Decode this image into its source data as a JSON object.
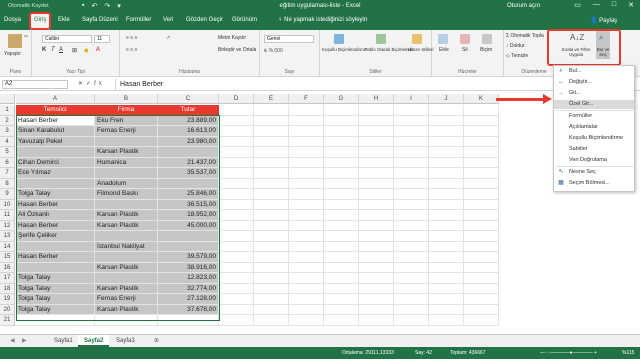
{
  "titlebar": {
    "autosave": "Otomatik Kaydet",
    "title": "eğitim uygulaması-liste  -  Excel",
    "user": "Oturum açın"
  },
  "tabs": [
    "Dosya",
    "Giriş",
    "Ekle",
    "Sayfa Düzeni",
    "Formüller",
    "Veri",
    "Gözden Geçir",
    "Görünüm"
  ],
  "tell_me": "Ne yapmak istediğinizi söyleyin",
  "share": "Paylaş",
  "ribbon": {
    "paste": "Yapıştır",
    "font_name": "Calibri",
    "font_size": "11",
    "wrap_text": "Metni Kaydır",
    "merge_center": "Birleştir ve Ortala",
    "number_format": "Genel",
    "conditional_format": "Koşullu Biçimlendirme",
    "format_as_table": "Tablo Olarak Biçimlendir",
    "cell_styles": "Hücre Stilleri",
    "insert": "Ekle",
    "delete": "Sil",
    "format": "Biçim",
    "autosum": "Otomatik Topla",
    "fill": "Doldur",
    "clear": "Temizle",
    "sort_filter": "Sırala ve Filtre Uygula",
    "find_select": "Bul ve Seç",
    "groups": {
      "clipboard": "Pano",
      "font": "Yazı Tipi",
      "alignment": "Hizalama",
      "number": "Sayı",
      "styles": "Stiller",
      "cells": "Hücreler",
      "editing": "Düzenleme"
    }
  },
  "formula_bar": {
    "name_box": "A2",
    "fx": "fx",
    "value": "Hasan Berber"
  },
  "columns": [
    "A",
    "B",
    "C",
    "D",
    "E",
    "F",
    "G",
    "H",
    "I",
    "J",
    "K"
  ],
  "rows": [
    "1",
    "2",
    "3",
    "4",
    "5",
    "6",
    "7",
    "8",
    "9",
    "10",
    "11",
    "12",
    "13",
    "14",
    "15",
    "16",
    "17",
    "18",
    "19",
    "20",
    "21"
  ],
  "table": {
    "headers": [
      "Temsilci",
      "Firma",
      "Tutar"
    ],
    "rows": [
      [
        "Hasan Berber",
        "Eku Fren",
        "23.889,00"
      ],
      [
        "Sinan Karabulut",
        "Fernas Enerji",
        "16.613,00"
      ],
      [
        "Yavuzalp Pekel",
        "",
        "23.980,00"
      ],
      [
        "",
        "Karsan Plastik",
        ""
      ],
      [
        "Cihan Demirci",
        "Humanica",
        "21.437,00"
      ],
      [
        "Ece Yılmaz",
        "",
        "35.537,00"
      ],
      [
        "",
        "Anadolum",
        ""
      ],
      [
        "Tolga Talay",
        "Filmond Baskı",
        "25.846,00"
      ],
      [
        "Hasan Berber",
        "",
        "36.515,00"
      ],
      [
        "Ali Özkanlı",
        "Karsan Plastik",
        "18.952,00"
      ],
      [
        "Hasan Berber",
        "Karsan Plastik",
        "45.000,00"
      ],
      [
        "Şerife Çeliker",
        "",
        ""
      ],
      [
        "",
        "İstanbul Nakliyat",
        ""
      ],
      [
        "Hasan Berber",
        "",
        "39.579,00"
      ],
      [
        "",
        "Karsan Plastik",
        "38.916,00"
      ],
      [
        "Tolga Talay",
        "",
        "12.823,00"
      ],
      [
        "Tolga Talay",
        "Karsan Plastik",
        "32.774,00"
      ],
      [
        "Tolga Talay",
        "Fernas Enerji",
        "27.128,00"
      ],
      [
        "Tolga Talay",
        "Karsan Plastik",
        "37.678,00"
      ]
    ]
  },
  "menu": {
    "items": [
      "Bul...",
      "Değiştir...",
      "Git...",
      "Özel Git...",
      "Formüller",
      "Açıklamalar",
      "Koşullu Biçimlendirme",
      "Sabitler",
      "Veri Doğrulama",
      "Nesne Seç",
      "Seçim Bölmesi..."
    ]
  },
  "sheets": [
    "Sayfa1",
    "Sayfa2",
    "Sayfa3"
  ],
  "status": {
    "average": "Ortalama: 29111,13333",
    "count": "Say: 42",
    "sum": "Toplam: 436667",
    "zoom": "%115"
  },
  "colors": {
    "excel_green": "#217346",
    "header_red": "#e8392f",
    "annotation_red": "#e8392f"
  }
}
